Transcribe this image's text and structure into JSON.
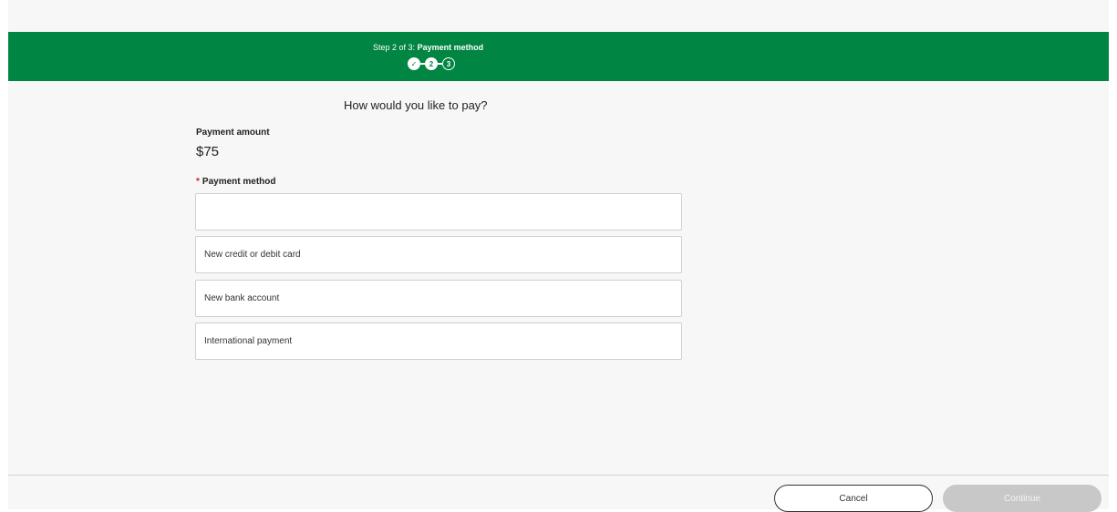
{
  "header": {
    "step_prefix": "Step 2 of 3:",
    "step_name": "Payment method",
    "steps": [
      {
        "state": "done",
        "icon": "checkmark-icon",
        "label": "✓"
      },
      {
        "state": "current",
        "label": "2"
      },
      {
        "state": "todo",
        "label": "3"
      }
    ],
    "background_color": "#008542"
  },
  "main": {
    "question": "How would you like to pay?",
    "amount_label": "Payment amount",
    "amount_value": "$75",
    "method_required_mark": "*",
    "method_label": "Payment method",
    "options": [
      {
        "label": ""
      },
      {
        "label": "New credit or debit card"
      },
      {
        "label": "New bank account"
      },
      {
        "label": "International payment"
      }
    ]
  },
  "footer": {
    "cancel_label": "Cancel",
    "continue_label": "Continue"
  }
}
